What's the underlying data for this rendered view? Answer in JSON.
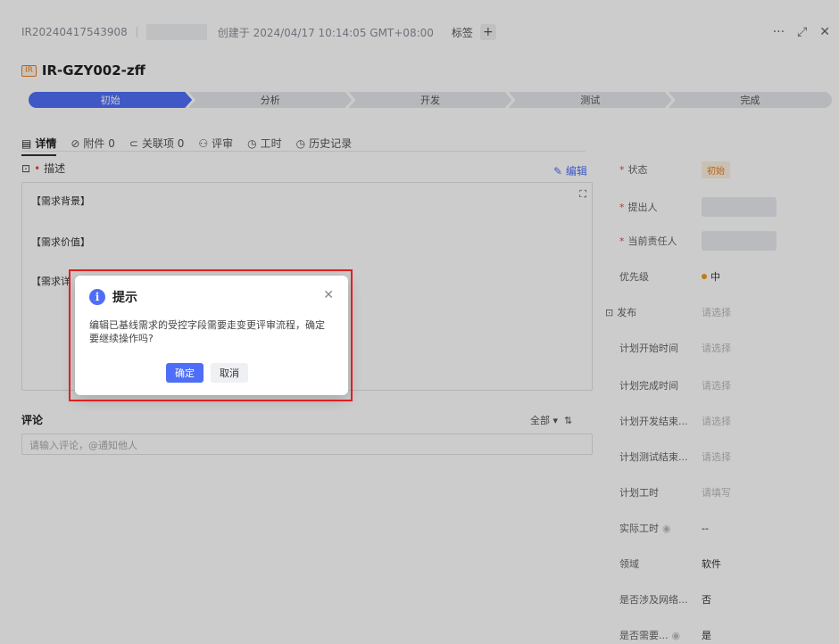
{
  "header": {
    "id": "IR20240417543908",
    "created": "创建于 2024/04/17 10:14:05 GMT+08:00",
    "tags_label": "标签",
    "add": "+",
    "more": "···",
    "expand": "⤢",
    "close": "✕"
  },
  "title": {
    "badge": "IR",
    "text": "IR-GZY002-zff"
  },
  "pipeline": [
    "初始",
    "分析",
    "开发",
    "测试",
    "完成"
  ],
  "tabs": [
    {
      "icon": "▤",
      "label": "详情"
    },
    {
      "icon": "⊘",
      "label": "附件 0"
    },
    {
      "icon": "⊂",
      "label": "关联项 0"
    },
    {
      "icon": "⚇",
      "label": "评审"
    },
    {
      "icon": "◷",
      "label": "工时"
    },
    {
      "icon": "◷",
      "label": "历史记录"
    }
  ],
  "description": {
    "label": "描述",
    "edit": "编辑",
    "lines": [
      "【需求背景】",
      "【需求价值】",
      "【需求详"
    ]
  },
  "comments": {
    "title": "评论",
    "filter": "全部",
    "placeholder": "请输入评论，@通知他人"
  },
  "side": [
    {
      "label": "状态",
      "value": "初始",
      "required": true
    },
    {
      "label": "提出人",
      "value": "",
      "required": true
    },
    {
      "label": "当前责任人",
      "value": "",
      "required": true
    },
    {
      "label": "优先级",
      "value": "中"
    },
    {
      "label": "发布",
      "value": "请选择"
    },
    {
      "label": "计划开始时间",
      "value": "请选择"
    },
    {
      "label": "计划完成时间",
      "value": "请选择"
    },
    {
      "label": "计划开发结束...",
      "value": "请选择"
    },
    {
      "label": "计划测试结束...",
      "value": "请选择"
    },
    {
      "label": "计划工时",
      "value": "请填写"
    },
    {
      "label": "实际工时",
      "value": "--"
    },
    {
      "label": "领域",
      "value": "软件"
    },
    {
      "label": "是否涉及网络...",
      "value": "否"
    },
    {
      "label": "是否需要...",
      "value": "是"
    }
  ],
  "dialog": {
    "title": "提示",
    "body": "编辑已基线需求的受控字段需要走变更评审流程，确定要继续操作吗?",
    "confirm": "确定",
    "cancel": "取消",
    "close": "✕"
  }
}
